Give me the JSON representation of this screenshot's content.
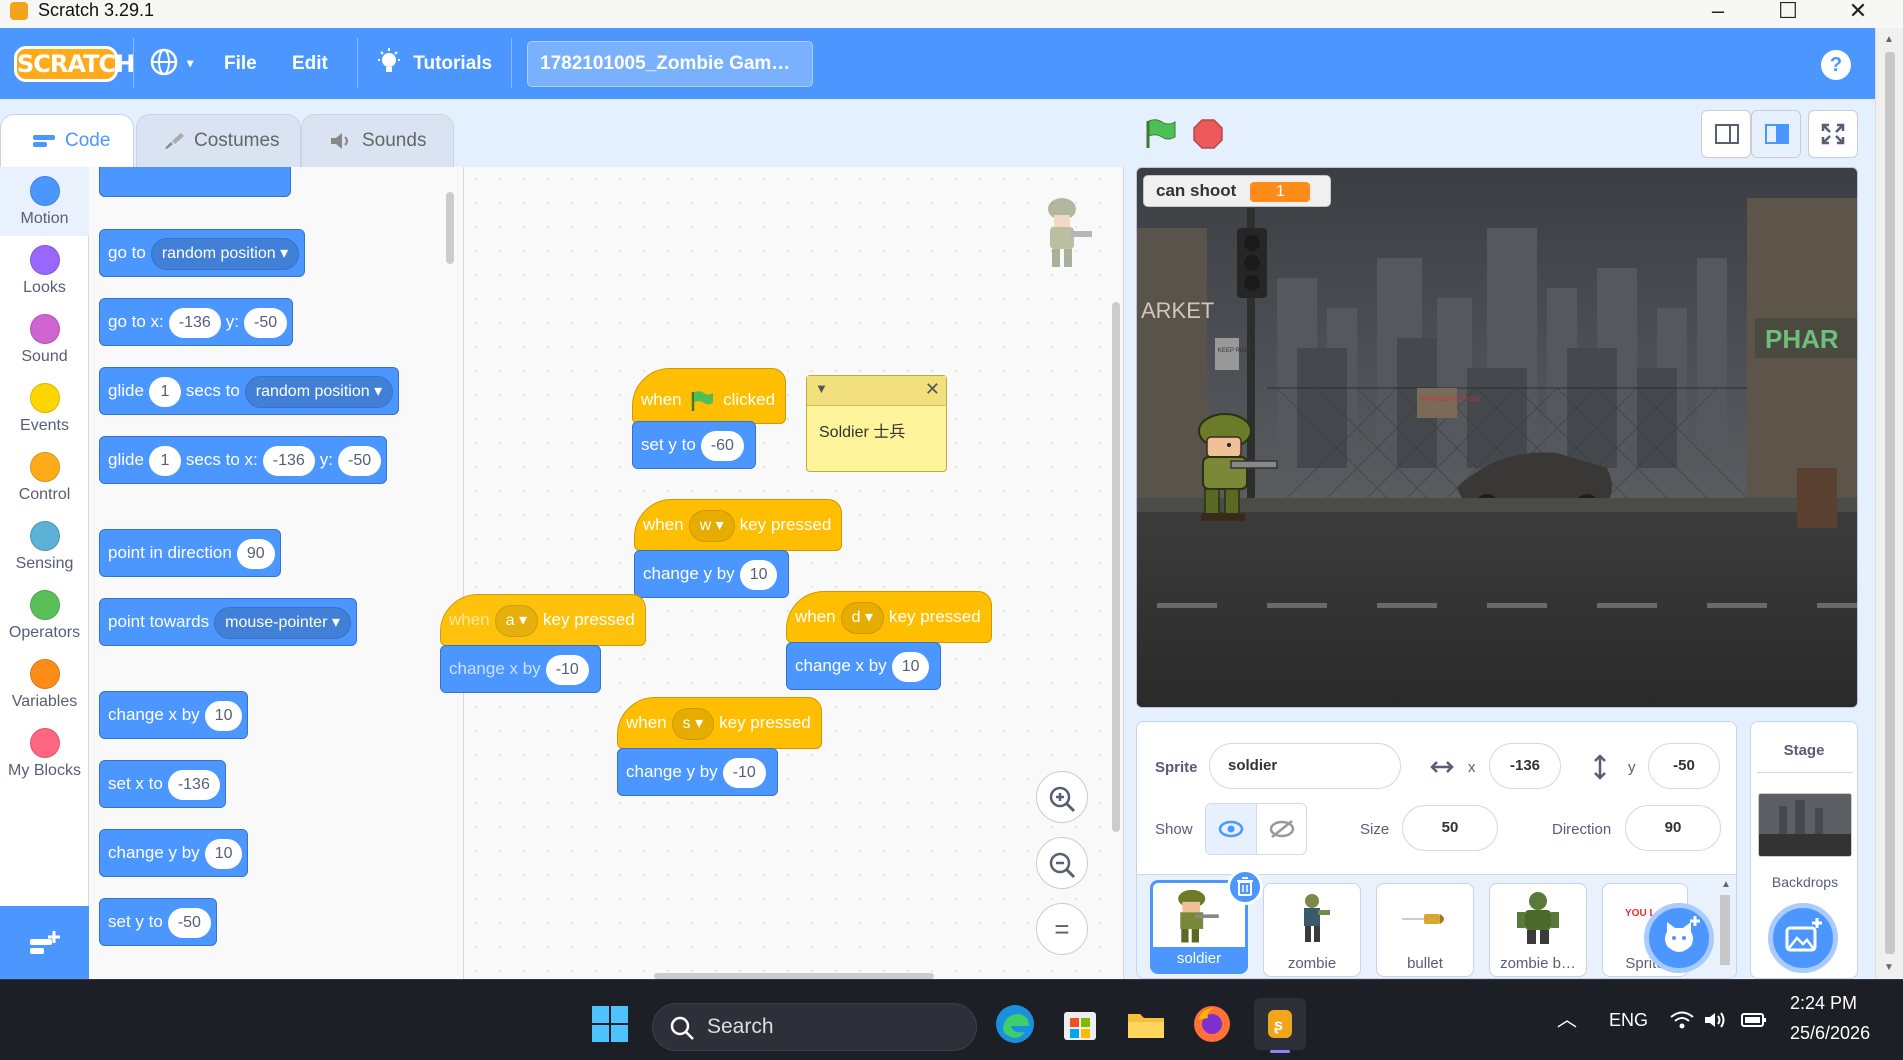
{
  "window": {
    "title": "Scratch 3.29.1"
  },
  "menubar": {
    "logo": "SCRATCH",
    "file": "File",
    "edit": "Edit",
    "tutorials": "Tutorials",
    "project_name": "1782101005_Zombie Gam…"
  },
  "tabs": {
    "code": "Code",
    "costumes": "Costumes",
    "sounds": "Sounds"
  },
  "categories": [
    {
      "label": "Motion",
      "color": "#4c97ff"
    },
    {
      "label": "Looks",
      "color": "#9966ff"
    },
    {
      "label": "Sound",
      "color": "#cf63cf"
    },
    {
      "label": "Events",
      "color": "#ffd500"
    },
    {
      "label": "Control",
      "color": "#ffab19"
    },
    {
      "label": "Sensing",
      "color": "#5cb1d6"
    },
    {
      "label": "Operators",
      "color": "#59c059"
    },
    {
      "label": "Variables",
      "color": "#ff8c1a"
    },
    {
      "label": "My Blocks",
      "color": "#ff6680"
    }
  ],
  "palette": {
    "goto": {
      "label": "go to",
      "target": "random position"
    },
    "gotoxy": {
      "label": "go to x:",
      "x": "-136",
      "ylabel": "y:",
      "y": "-50"
    },
    "glide1": {
      "label": "glide",
      "secs": "1",
      "mid": "secs to",
      "target": "random position"
    },
    "glide2": {
      "label": "glide",
      "secs": "1",
      "mid": "secs to x:",
      "x": "-136",
      "ylabel": "y:",
      "y": "-50"
    },
    "point_dir": {
      "label": "point in direction",
      "value": "90"
    },
    "point_towards": {
      "label": "point towards",
      "target": "mouse-pointer"
    },
    "change_x": {
      "label": "change x by",
      "value": "10"
    },
    "set_x": {
      "label": "set x to",
      "value": "-136"
    },
    "change_y": {
      "label": "change y by",
      "value": "10"
    },
    "set_y": {
      "label": "set y to",
      "value": "-50"
    }
  },
  "scripts": {
    "flag": {
      "when": "when",
      "clicked": "clicked",
      "set_label": "set y to",
      "set_value": "-60"
    },
    "w": {
      "when": "when",
      "key": "w",
      "pressed": "key pressed",
      "action": "change y by",
      "value": "10"
    },
    "a": {
      "when": "when",
      "key": "a",
      "pressed": "key pressed",
      "action": "change x by",
      "value": "-10"
    },
    "d": {
      "when": "when",
      "key": "d",
      "pressed": "key pressed",
      "action": "change x by",
      "value": "10"
    },
    "s": {
      "when": "when",
      "key": "s",
      "pressed": "key pressed",
      "action": "change y by",
      "value": "-10"
    },
    "comment": "Soldier 士兵"
  },
  "stage": {
    "monitor_label": "can shoot",
    "monitor_value": "1",
    "sign_market": "ARKET",
    "sign_pharmacy": "PHAR",
    "sign_keep": "KEEP RIGHT",
    "sign_warning": "WARNING KEEP OUT"
  },
  "sprite_info": {
    "sprite_label": "Sprite",
    "sprite_name": "soldier",
    "x_label": "x",
    "x_value": "-136",
    "y_label": "y",
    "y_value": "-50",
    "show_label": "Show",
    "size_label": "Size",
    "size_value": "50",
    "direction_label": "Direction",
    "direction_value": "90"
  },
  "sprites": [
    {
      "name": "soldier"
    },
    {
      "name": "zombie"
    },
    {
      "name": "bullet"
    },
    {
      "name": "zombie b…"
    },
    {
      "name": "Sprite",
      "thumb_text": "YOU L"
    }
  ],
  "stage_pane": {
    "title": "Stage",
    "backdrops": "Backdrops"
  },
  "taskbar": {
    "search": "Search",
    "lang": "ENG",
    "time": "2:24 PM",
    "date": "25/6/2026"
  }
}
